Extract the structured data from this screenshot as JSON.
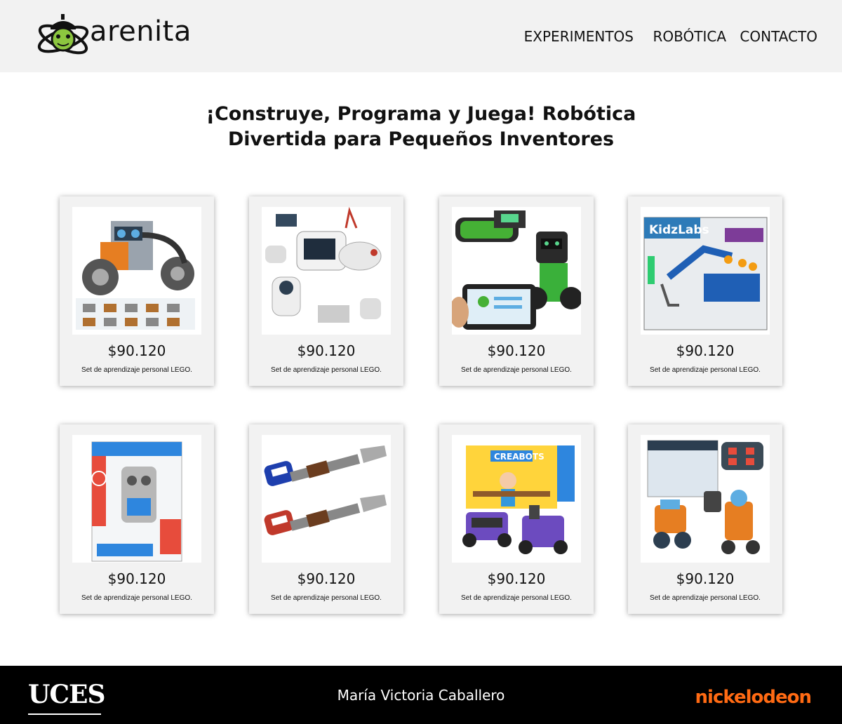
{
  "header": {
    "brand": "arenita",
    "nav": {
      "experimentos": "EXPERIMENTOS",
      "robotica": "ROBÓTICA",
      "contacto": "CONTACTO"
    }
  },
  "page": {
    "title_line1": "¡Construye, Programa y Juega! Robótica",
    "title_line2": "Divertida para Pequeños Inventores"
  },
  "products": [
    {
      "price": "$90.120",
      "description": "Set de aprendizaje personal LEGO.",
      "image": "solar-robot-kit-image"
    },
    {
      "price": "$90.120",
      "description": "Set de aprendizaje personal LEGO.",
      "image": "solar-space-robot-image"
    },
    {
      "price": "$90.120",
      "description": "Set de aprendizaje personal LEGO.",
      "image": "green-app-robot-image"
    },
    {
      "price": "$90.120",
      "description": "Set de aprendizaje personal LEGO.",
      "image": "kidzlabs-hydraulic-arm-image"
    },
    {
      "price": "$90.120",
      "description": "Set de aprendizaje personal LEGO.",
      "image": "eco-ciencia-robot-box-image"
    },
    {
      "price": "$90.120",
      "description": "Set de aprendizaje personal LEGO.",
      "image": "robotic-hand-grabbers-image"
    },
    {
      "price": "$90.120",
      "description": "Set de aprendizaje personal LEGO.",
      "image": "creabots-kit-image"
    },
    {
      "price": "$90.120",
      "description": "Set de aprendizaje personal LEGO.",
      "image": "rc-robot-kit-image"
    }
  ],
  "footer": {
    "left_logo": "UCES",
    "author": "María Victoria Caballero",
    "right_logo": "nickelodeon"
  },
  "colors": {
    "header_bg": "#f2f2f2",
    "card_bg": "#f2f2f2",
    "footer_bg": "#000000",
    "nickelodeon_orange": "#ff6a13",
    "logo_green": "#8cc63f"
  }
}
